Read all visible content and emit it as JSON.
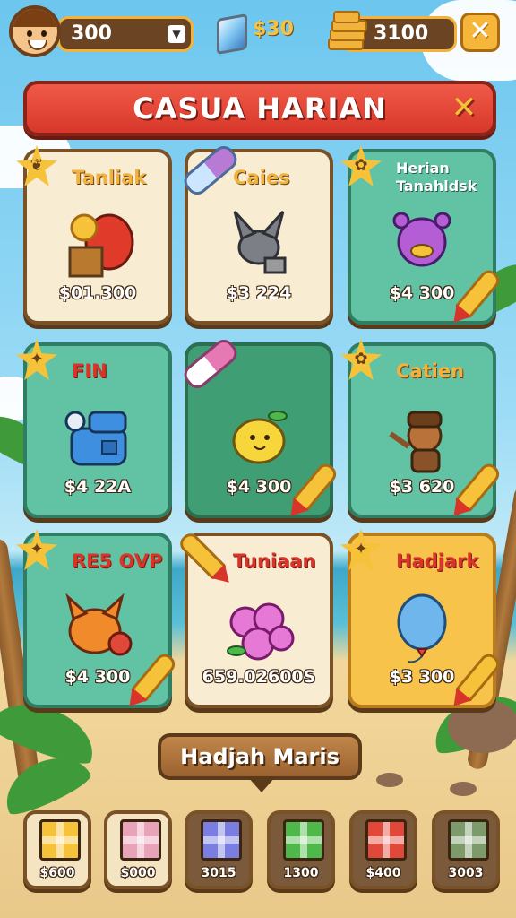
{
  "header": {
    "currency_1": "300",
    "gem_value": "$30",
    "currency_2": "3100",
    "close_symbol": "✕"
  },
  "banner": {
    "title": "CASUA HARIAN",
    "close_symbol": "✕"
  },
  "cards": [
    {
      "title": "Tanliak",
      "price": "$01.300",
      "badge": "leaf",
      "item": "red-fish-with-coin"
    },
    {
      "title": "Caies",
      "price": "$3 224",
      "badge": "capsule",
      "item": "gray-bat"
    },
    {
      "title": "Herian Tanahldsk",
      "price": "$4 300",
      "badge": "feather",
      "item": "purple-duck"
    },
    {
      "title": "FIN",
      "price": "$4 22A",
      "badge": "star",
      "item": "blue-mailbox"
    },
    {
      "title": "",
      "price": "$4 300",
      "badge": "capsule",
      "item": "lemon"
    },
    {
      "title": "Catien",
      "price": "$3 620",
      "badge": "feather",
      "item": "brown-cowboy"
    },
    {
      "title": "RE5 OVP",
      "price": "$4 300",
      "badge": "star",
      "item": "orange-fox"
    },
    {
      "title": "Tuniaan",
      "price": "659.02600S",
      "badge": "pencil",
      "item": "pink-berries"
    },
    {
      "title": "Hadjark",
      "price": "$3 300",
      "badge": "star",
      "item": "blue-balloon"
    }
  ],
  "ribbon": {
    "label": "Hadjah Maris"
  },
  "bottom_items": [
    {
      "price": "$600",
      "color": "#f6c23a"
    },
    {
      "price": "$000",
      "color": "#e9a3b8"
    },
    {
      "price": "3015",
      "color": "#7a7ee0"
    },
    {
      "price": "1300",
      "color": "#4fb84a"
    },
    {
      "price": "$400",
      "color": "#e0483a"
    },
    {
      "price": "3003",
      "color": "#7d9a6b"
    }
  ]
}
